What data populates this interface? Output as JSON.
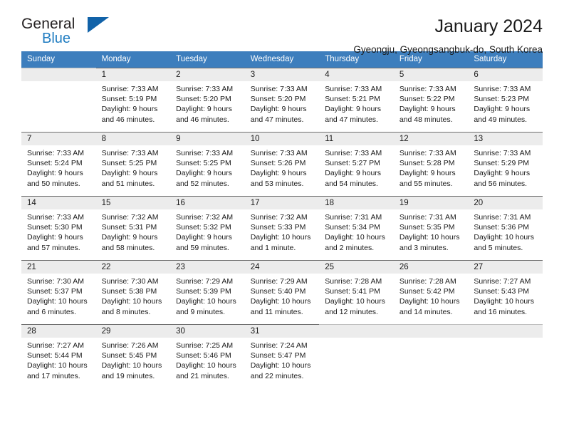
{
  "brand": {
    "name_top": "General",
    "name_bottom": "Blue",
    "accent_color": "#1162a8",
    "blue_text_color": "#1f7cc1",
    "triangle_icon": "brand-triangle-icon"
  },
  "header": {
    "title": "January 2024",
    "subtitle": "Gyeongju, Gyeongsangbuk-do, South Korea"
  },
  "calendar": {
    "header_bg": "#3d7ebd",
    "daynum_bg": "#ececec",
    "weekday_headers": [
      "Sunday",
      "Monday",
      "Tuesday",
      "Wednesday",
      "Thursday",
      "Friday",
      "Saturday"
    ],
    "labels": {
      "sunrise": "Sunrise:",
      "sunset": "Sunset:",
      "daylight": "Daylight:"
    },
    "weeks": [
      [
        {
          "day": "",
          "sunrise": "",
          "sunset": "",
          "daylight_line1": "",
          "daylight_line2": ""
        },
        {
          "day": "1",
          "sunrise": "Sunrise: 7:33 AM",
          "sunset": "Sunset: 5:19 PM",
          "daylight_line1": "Daylight: 9 hours",
          "daylight_line2": "and 46 minutes."
        },
        {
          "day": "2",
          "sunrise": "Sunrise: 7:33 AM",
          "sunset": "Sunset: 5:20 PM",
          "daylight_line1": "Daylight: 9 hours",
          "daylight_line2": "and 46 minutes."
        },
        {
          "day": "3",
          "sunrise": "Sunrise: 7:33 AM",
          "sunset": "Sunset: 5:20 PM",
          "daylight_line1": "Daylight: 9 hours",
          "daylight_line2": "and 47 minutes."
        },
        {
          "day": "4",
          "sunrise": "Sunrise: 7:33 AM",
          "sunset": "Sunset: 5:21 PM",
          "daylight_line1": "Daylight: 9 hours",
          "daylight_line2": "and 47 minutes."
        },
        {
          "day": "5",
          "sunrise": "Sunrise: 7:33 AM",
          "sunset": "Sunset: 5:22 PM",
          "daylight_line1": "Daylight: 9 hours",
          "daylight_line2": "and 48 minutes."
        },
        {
          "day": "6",
          "sunrise": "Sunrise: 7:33 AM",
          "sunset": "Sunset: 5:23 PM",
          "daylight_line1": "Daylight: 9 hours",
          "daylight_line2": "and 49 minutes."
        }
      ],
      [
        {
          "day": "7",
          "sunrise": "Sunrise: 7:33 AM",
          "sunset": "Sunset: 5:24 PM",
          "daylight_line1": "Daylight: 9 hours",
          "daylight_line2": "and 50 minutes."
        },
        {
          "day": "8",
          "sunrise": "Sunrise: 7:33 AM",
          "sunset": "Sunset: 5:25 PM",
          "daylight_line1": "Daylight: 9 hours",
          "daylight_line2": "and 51 minutes."
        },
        {
          "day": "9",
          "sunrise": "Sunrise: 7:33 AM",
          "sunset": "Sunset: 5:25 PM",
          "daylight_line1": "Daylight: 9 hours",
          "daylight_line2": "and 52 minutes."
        },
        {
          "day": "10",
          "sunrise": "Sunrise: 7:33 AM",
          "sunset": "Sunset: 5:26 PM",
          "daylight_line1": "Daylight: 9 hours",
          "daylight_line2": "and 53 minutes."
        },
        {
          "day": "11",
          "sunrise": "Sunrise: 7:33 AM",
          "sunset": "Sunset: 5:27 PM",
          "daylight_line1": "Daylight: 9 hours",
          "daylight_line2": "and 54 minutes."
        },
        {
          "day": "12",
          "sunrise": "Sunrise: 7:33 AM",
          "sunset": "Sunset: 5:28 PM",
          "daylight_line1": "Daylight: 9 hours",
          "daylight_line2": "and 55 minutes."
        },
        {
          "day": "13",
          "sunrise": "Sunrise: 7:33 AM",
          "sunset": "Sunset: 5:29 PM",
          "daylight_line1": "Daylight: 9 hours",
          "daylight_line2": "and 56 minutes."
        }
      ],
      [
        {
          "day": "14",
          "sunrise": "Sunrise: 7:33 AM",
          "sunset": "Sunset: 5:30 PM",
          "daylight_line1": "Daylight: 9 hours",
          "daylight_line2": "and 57 minutes."
        },
        {
          "day": "15",
          "sunrise": "Sunrise: 7:32 AM",
          "sunset": "Sunset: 5:31 PM",
          "daylight_line1": "Daylight: 9 hours",
          "daylight_line2": "and 58 minutes."
        },
        {
          "day": "16",
          "sunrise": "Sunrise: 7:32 AM",
          "sunset": "Sunset: 5:32 PM",
          "daylight_line1": "Daylight: 9 hours",
          "daylight_line2": "and 59 minutes."
        },
        {
          "day": "17",
          "sunrise": "Sunrise: 7:32 AM",
          "sunset": "Sunset: 5:33 PM",
          "daylight_line1": "Daylight: 10 hours",
          "daylight_line2": "and 1 minute."
        },
        {
          "day": "18",
          "sunrise": "Sunrise: 7:31 AM",
          "sunset": "Sunset: 5:34 PM",
          "daylight_line1": "Daylight: 10 hours",
          "daylight_line2": "and 2 minutes."
        },
        {
          "day": "19",
          "sunrise": "Sunrise: 7:31 AM",
          "sunset": "Sunset: 5:35 PM",
          "daylight_line1": "Daylight: 10 hours",
          "daylight_line2": "and 3 minutes."
        },
        {
          "day": "20",
          "sunrise": "Sunrise: 7:31 AM",
          "sunset": "Sunset: 5:36 PM",
          "daylight_line1": "Daylight: 10 hours",
          "daylight_line2": "and 5 minutes."
        }
      ],
      [
        {
          "day": "21",
          "sunrise": "Sunrise: 7:30 AM",
          "sunset": "Sunset: 5:37 PM",
          "daylight_line1": "Daylight: 10 hours",
          "daylight_line2": "and 6 minutes."
        },
        {
          "day": "22",
          "sunrise": "Sunrise: 7:30 AM",
          "sunset": "Sunset: 5:38 PM",
          "daylight_line1": "Daylight: 10 hours",
          "daylight_line2": "and 8 minutes."
        },
        {
          "day": "23",
          "sunrise": "Sunrise: 7:29 AM",
          "sunset": "Sunset: 5:39 PM",
          "daylight_line1": "Daylight: 10 hours",
          "daylight_line2": "and 9 minutes."
        },
        {
          "day": "24",
          "sunrise": "Sunrise: 7:29 AM",
          "sunset": "Sunset: 5:40 PM",
          "daylight_line1": "Daylight: 10 hours",
          "daylight_line2": "and 11 minutes."
        },
        {
          "day": "25",
          "sunrise": "Sunrise: 7:28 AM",
          "sunset": "Sunset: 5:41 PM",
          "daylight_line1": "Daylight: 10 hours",
          "daylight_line2": "and 12 minutes."
        },
        {
          "day": "26",
          "sunrise": "Sunrise: 7:28 AM",
          "sunset": "Sunset: 5:42 PM",
          "daylight_line1": "Daylight: 10 hours",
          "daylight_line2": "and 14 minutes."
        },
        {
          "day": "27",
          "sunrise": "Sunrise: 7:27 AM",
          "sunset": "Sunset: 5:43 PM",
          "daylight_line1": "Daylight: 10 hours",
          "daylight_line2": "and 16 minutes."
        }
      ],
      [
        {
          "day": "28",
          "sunrise": "Sunrise: 7:27 AM",
          "sunset": "Sunset: 5:44 PM",
          "daylight_line1": "Daylight: 10 hours",
          "daylight_line2": "and 17 minutes."
        },
        {
          "day": "29",
          "sunrise": "Sunrise: 7:26 AM",
          "sunset": "Sunset: 5:45 PM",
          "daylight_line1": "Daylight: 10 hours",
          "daylight_line2": "and 19 minutes."
        },
        {
          "day": "30",
          "sunrise": "Sunrise: 7:25 AM",
          "sunset": "Sunset: 5:46 PM",
          "daylight_line1": "Daylight: 10 hours",
          "daylight_line2": "and 21 minutes."
        },
        {
          "day": "31",
          "sunrise": "Sunrise: 7:24 AM",
          "sunset": "Sunset: 5:47 PM",
          "daylight_line1": "Daylight: 10 hours",
          "daylight_line2": "and 22 minutes."
        },
        {
          "day": "",
          "sunrise": "",
          "sunset": "",
          "daylight_line1": "",
          "daylight_line2": ""
        },
        {
          "day": "",
          "sunrise": "",
          "sunset": "",
          "daylight_line1": "",
          "daylight_line2": ""
        },
        {
          "day": "",
          "sunrise": "",
          "sunset": "",
          "daylight_line1": "",
          "daylight_line2": ""
        }
      ]
    ]
  }
}
